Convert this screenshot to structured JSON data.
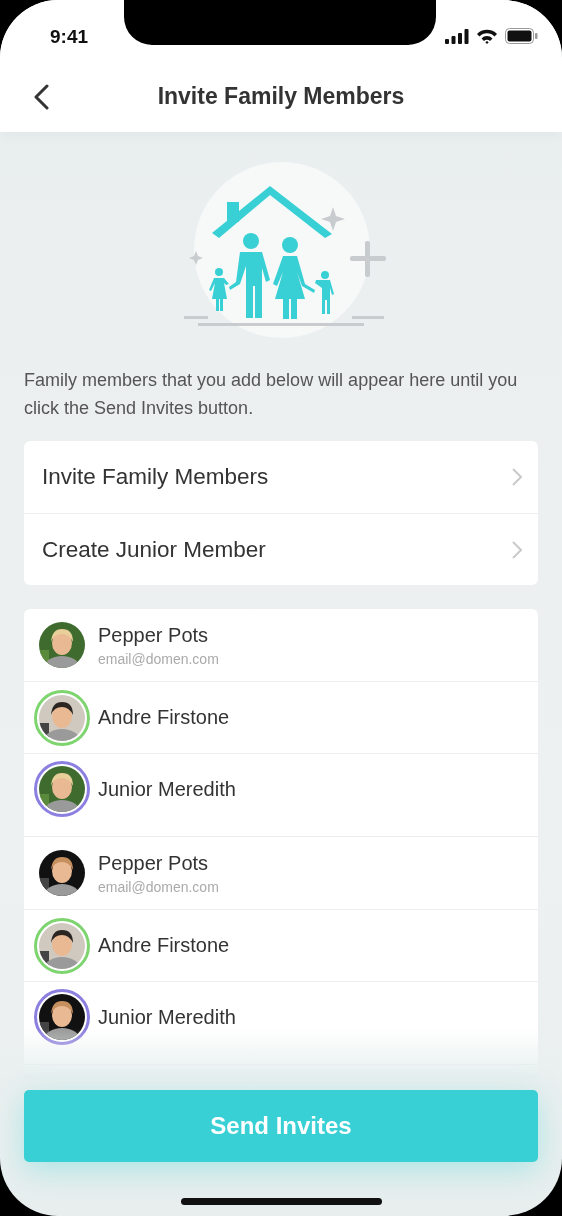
{
  "status_bar": {
    "time": "9:41"
  },
  "nav": {
    "title": "Invite Family Members"
  },
  "description": "Family members that you add below will appear here until you click the Send Invites button.",
  "menu": [
    {
      "label": "Invite Family Members"
    },
    {
      "label": "Create Junior Member"
    }
  ],
  "members": [
    {
      "name": "Pepper Pots",
      "email": "email@domen.com"
    },
    {
      "name": "Andre Firstone",
      "color": "#7ed46f"
    },
    {
      "name": "Junior Meredith",
      "color": "#8b7fe0"
    },
    {
      "name": "Pepper Pots",
      "email": "email@domen.com"
    },
    {
      "name": "Andre Firstone",
      "color": "#7ed46f"
    },
    {
      "name": "Junior Meredith",
      "color": "#8b7fe0"
    }
  ],
  "send_button": {
    "label": "Send Invites"
  }
}
